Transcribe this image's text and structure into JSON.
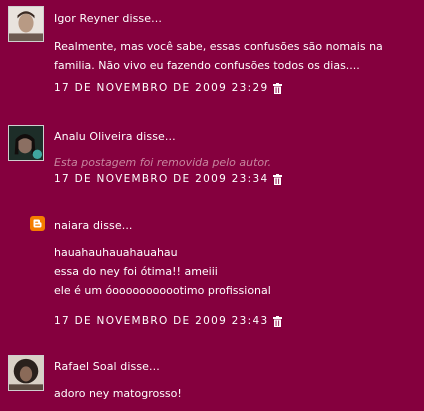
{
  "comments": [
    {
      "author": "Igor Reyner disse...",
      "lines": [
        "Realmente, mas você sabe, essas confusões são nomais na",
        "familia. Não vivo eu fazendo confusões todos os dias...."
      ],
      "timestamp": "17 DE NOVEMBRO DE 2009 23:29",
      "avatar_icon": "profile-photo"
    },
    {
      "author": "Analu Oliveira disse...",
      "removed_text": "Esta postagem foi removida pelo autor.",
      "timestamp": "17 DE NOVEMBRO DE 2009 23:34",
      "avatar_icon": "profile-photo"
    },
    {
      "author": "naiara disse...",
      "lines": [
        "hauahauhauahauahau",
        "essa do ney foi ótima!! ameiii",
        "ele é um óooooooooootimo profissional"
      ],
      "timestamp": "17 DE NOVEMBRO DE 2009 23:43",
      "avatar_icon": "blogger-icon"
    },
    {
      "author": "Rafael Soal disse...",
      "lines": [
        "adoro ney matogrosso!"
      ],
      "avatar_icon": "profile-photo"
    }
  ],
  "colors": {
    "background": "#85003e",
    "text": "#ffffff",
    "removed_text": "#c8869f",
    "blogger_orange": "#f57d00"
  }
}
